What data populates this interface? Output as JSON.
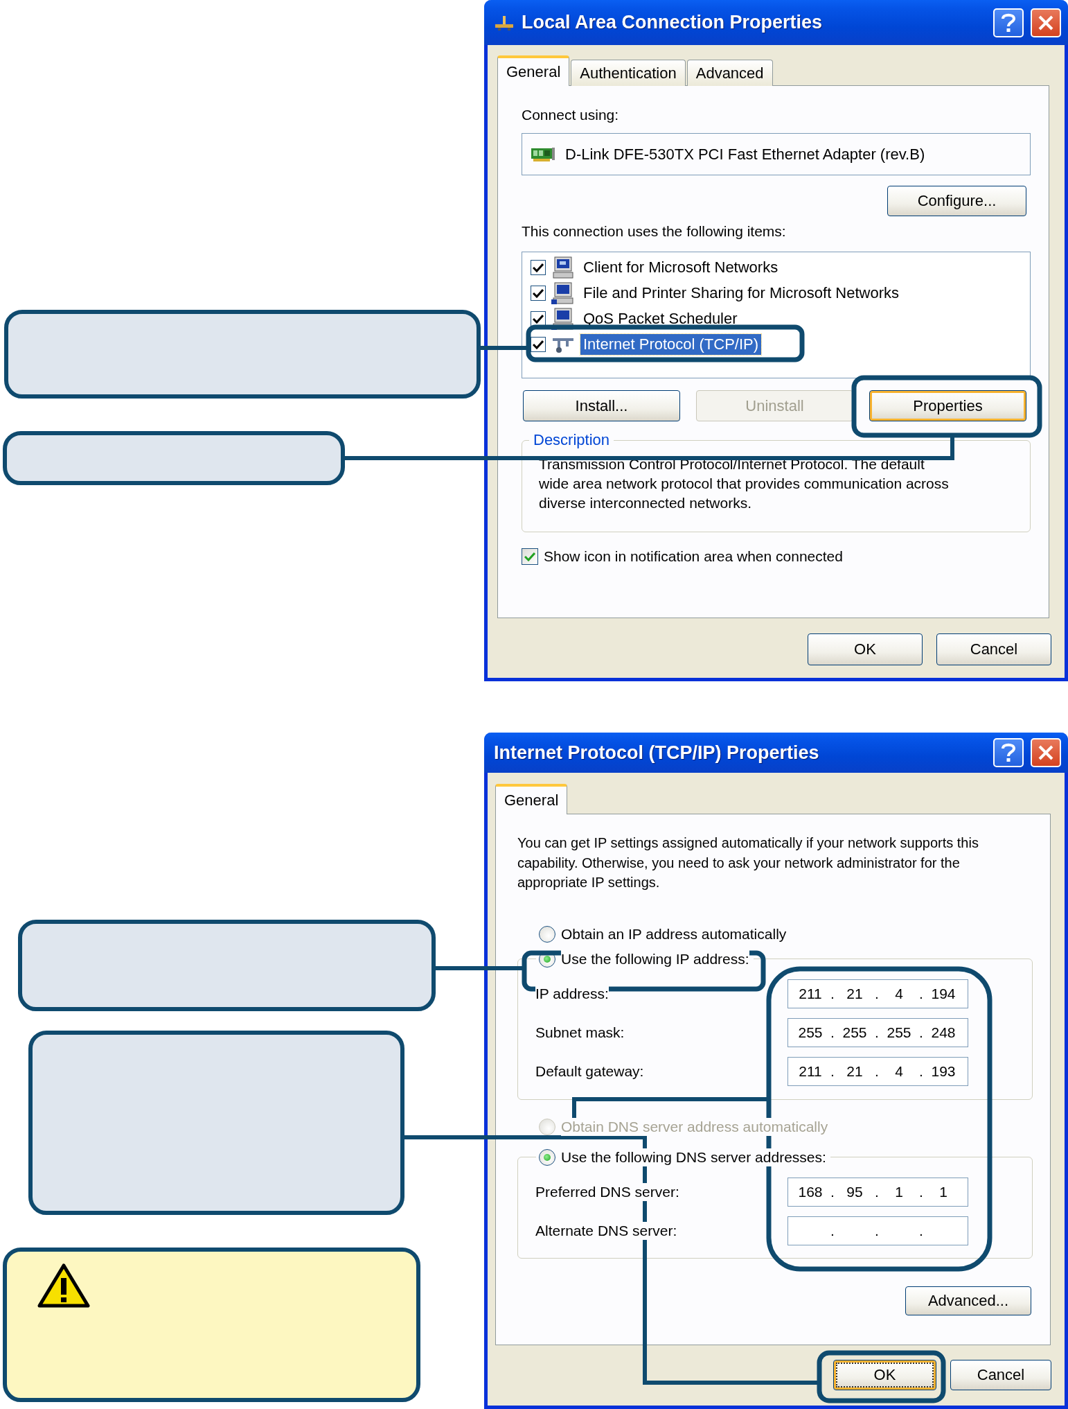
{
  "connection_dialog": {
    "title": "Local Area Connection Properties",
    "tabs": [
      {
        "label": "General",
        "selected": true
      },
      {
        "label": "Authentication",
        "selected": false
      },
      {
        "label": "Advanced",
        "selected": false
      }
    ],
    "connect_label": "Connect using:",
    "adapter": "D-Link DFE-530TX PCI Fast Ethernet Adapter (rev.B)",
    "configure_button": "Configure...",
    "items_label": "This connection uses the following items:",
    "items": [
      {
        "kind": "client",
        "label": "Client for Microsoft Networks",
        "checked": true,
        "selected": false
      },
      {
        "kind": "service",
        "label": "File and Printer Sharing for Microsoft Networks",
        "checked": true,
        "selected": false
      },
      {
        "kind": "service",
        "label": "QoS Packet Scheduler",
        "checked": true,
        "selected": false
      },
      {
        "kind": "protocol",
        "label": "Internet Protocol (TCP/IP)",
        "checked": true,
        "selected": true
      }
    ],
    "item_buttons": [
      {
        "label": "Install...",
        "disabled": false,
        "default": false
      },
      {
        "label": "Uninstall",
        "disabled": true,
        "default": false
      },
      {
        "label": "Properties",
        "disabled": false,
        "default": true
      }
    ],
    "description": {
      "legend": "Description",
      "text": "Transmission Control Protocol/Internet Protocol. The default wide area network protocol that provides communication across diverse interconnected networks."
    },
    "notify_checkbox": {
      "label": "Show icon in notification area when connected",
      "checked": true
    },
    "footer_buttons": [
      {
        "label": "OK",
        "default": false
      },
      {
        "label": "Cancel",
        "default": false
      }
    ]
  },
  "connection_callouts": [
    {
      "kind": "note"
    },
    {
      "kind": "note"
    }
  ],
  "tcpip_dialog": {
    "title": "Internet Protocol (TCP/IP) Properties",
    "tabs": [
      {
        "label": "General",
        "selected": true
      }
    ],
    "intro": "You can get IP settings assigned automatically if your network supports this capability. Otherwise, you need to ask your network administrator for the appropriate IP settings.",
    "ip_radios": [
      {
        "label": "Obtain an IP address automatically",
        "selected": false,
        "disabled": false
      },
      {
        "label": "Use the following IP address:",
        "selected": true,
        "disabled": false
      }
    ],
    "ip_fields": [
      {
        "label": "IP address:",
        "octets": [
          "211",
          "21",
          "4",
          "194"
        ],
        "dots": [
          ".",
          ".",
          "."
        ]
      },
      {
        "label": "Subnet mask:",
        "octets": [
          "255",
          "255",
          "255",
          "248"
        ],
        "dots": [
          ".",
          ".",
          "."
        ]
      },
      {
        "label": "Default gateway:",
        "octets": [
          "211",
          "21",
          "4",
          "193"
        ],
        "dots": [
          ".",
          ".",
          "."
        ]
      }
    ],
    "dns_radios": [
      {
        "label": "Obtain DNS server address automatically",
        "selected": false,
        "disabled": true
      },
      {
        "label": "Use the following DNS server addresses:",
        "selected": true,
        "disabled": false
      }
    ],
    "dns_fields": [
      {
        "label": "Preferred DNS server:",
        "octets": [
          "168",
          "95",
          "1",
          "1"
        ],
        "dots": [
          ".",
          ".",
          "."
        ]
      },
      {
        "label": "Alternate DNS server:",
        "dots": [
          ".",
          ".",
          "."
        ]
      }
    ],
    "advanced_button": "Advanced...",
    "footer_buttons": [
      {
        "label": "OK",
        "default": true,
        "focused": true
      },
      {
        "label": "Cancel",
        "default": false,
        "focused": false
      }
    ]
  },
  "tcpip_callouts": [
    {
      "kind": "note"
    },
    {
      "kind": "note"
    },
    {
      "kind": "warning"
    }
  ]
}
